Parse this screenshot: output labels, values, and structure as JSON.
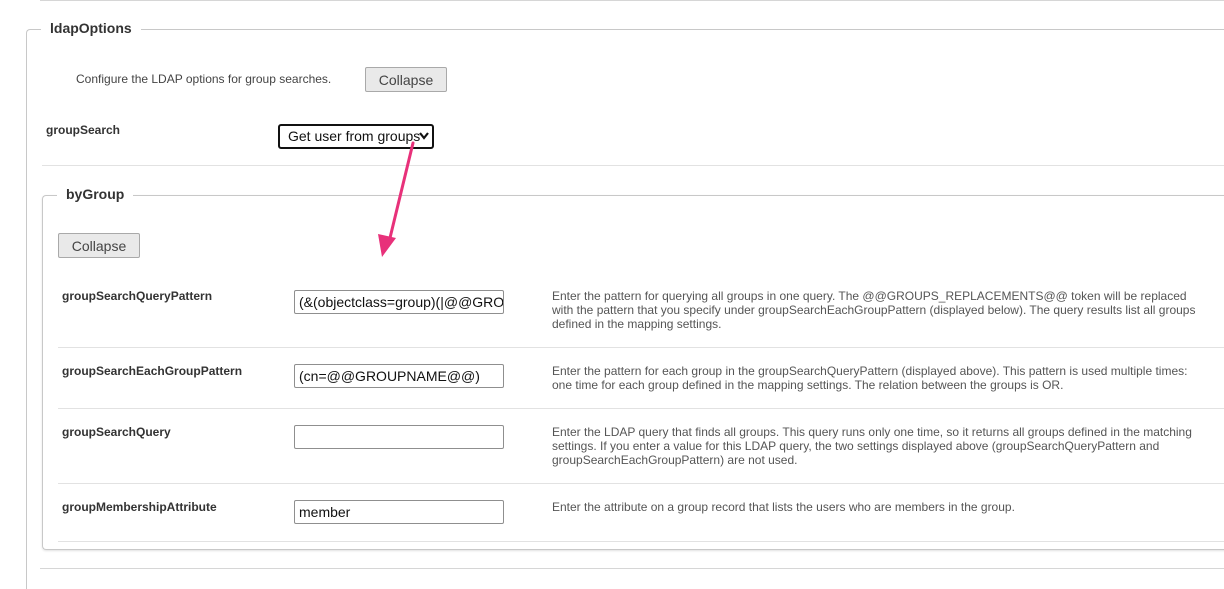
{
  "ldap_options": {
    "legend": "ldapOptions",
    "intro": "Configure the LDAP options for group searches.",
    "collapse_label": "Collapse",
    "group_search": {
      "label": "groupSearch",
      "selected": "Get user from groups"
    }
  },
  "by_group": {
    "legend": "byGroup",
    "collapse_label": "Collapse",
    "rows": [
      {
        "label": "groupSearchQueryPattern",
        "value": "(&(objectclass=group)(|@@GROUPS_REPLACEMENTS@@))",
        "description": "Enter the pattern for querying all groups in one query. The @@GROUPS_REPLACEMENTS@@ token will be replaced with the pattern that you specify under groupSearchEachGroupPattern (displayed below). The query results list all groups defined in the mapping settings."
      },
      {
        "label": "groupSearchEachGroupPattern",
        "value": "(cn=@@GROUPNAME@@)",
        "description": "Enter the pattern for each group in the groupSearchQueryPattern (displayed above). This pattern is used multiple times: one time for each group defined in the mapping settings. The relation between the groups is OR."
      },
      {
        "label": "groupSearchQuery",
        "value": "",
        "description": "Enter the LDAP query that finds all groups. This query runs only one time, so it returns all groups defined in the matching settings. If you enter a value for this LDAP query, the two settings displayed above (groupSearchQueryPattern and groupSearchEachGroupPattern) are not used."
      },
      {
        "label": "groupMembershipAttribute",
        "value": "member",
        "description": "Enter the attribute on a group record that lists the users who are members in the group."
      }
    ]
  },
  "annotation": {
    "arrow_color": "#e8317a",
    "icon": "pointer-arrow-icon"
  },
  "icons": {
    "select_caret": "chevron-down-icon"
  }
}
